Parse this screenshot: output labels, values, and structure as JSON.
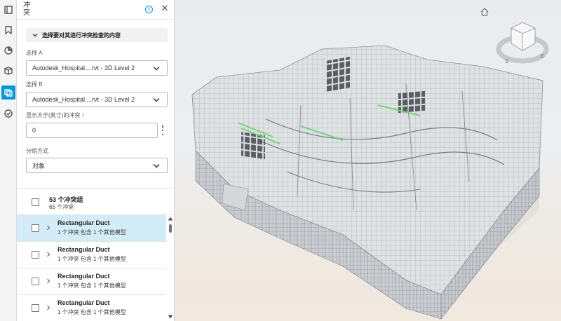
{
  "rail": {
    "items": [
      {
        "name": "model-browser-icon"
      },
      {
        "name": "bookmark-icon"
      },
      {
        "name": "sheets-icon"
      },
      {
        "name": "cube-search-icon"
      },
      {
        "name": "clash-icon",
        "active": true
      },
      {
        "name": "checkmark-circle-icon"
      }
    ]
  },
  "panel": {
    "title": "冲突",
    "section_label": "选择要对其进行冲突检查的内容",
    "selection_a": {
      "label": "选择 A",
      "value": "Autodesk_Hospital....rvt - 3D Level 2"
    },
    "selection_b": {
      "label": "选择 B",
      "value": "Autodesk_Hospital....rvt - 3D Level 2"
    },
    "threshold": {
      "label": "显示大于(英寸)的冲突 ↑",
      "value": "0"
    },
    "group_by": {
      "label": "分组方式",
      "value": "对象"
    }
  },
  "clash_groups": {
    "title": "53 个冲突组",
    "subtitle": "65 个冲突"
  },
  "rows": [
    {
      "title": "Rectangular Duct",
      "subtitle": "1 个冲突 包含 1 个其他模型",
      "selected": true
    },
    {
      "title": "Rectangular Duct",
      "subtitle": "1 个冲突 包含 1 个其他模型",
      "selected": false
    },
    {
      "title": "Rectangular Duct",
      "subtitle": "1 个冲突 包含 1 个其他模型",
      "selected": false
    },
    {
      "title": "Rectangular Duct",
      "subtitle": "1 个冲突 包含 1 个其他模型",
      "selected": false
    }
  ],
  "viewcube": {
    "compass_south": "S",
    "compass_east": "E"
  },
  "colors": {
    "accent": "#0696d7",
    "selected_row": "#d3ecf8",
    "clash_highlight": "#6fd36f"
  }
}
